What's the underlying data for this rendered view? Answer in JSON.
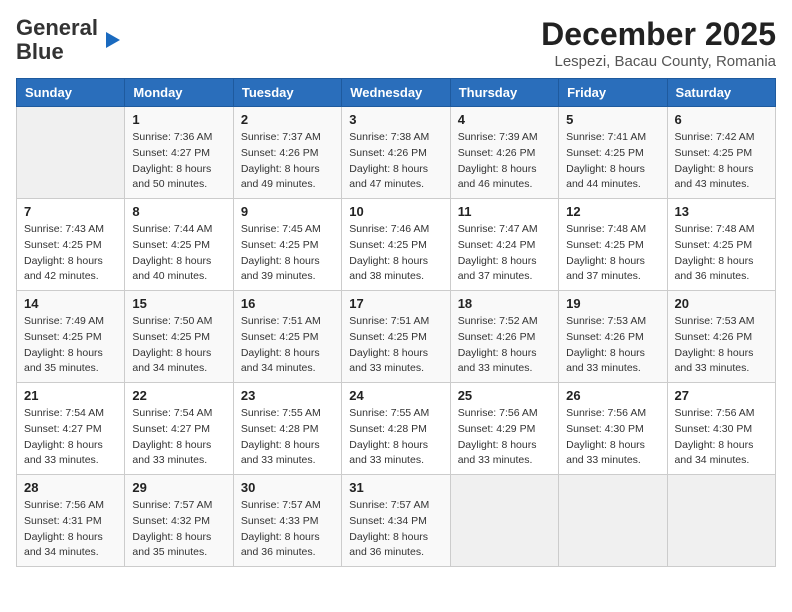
{
  "header": {
    "logo_line1": "General",
    "logo_line2": "Blue",
    "month_year": "December 2025",
    "location": "Lespezi, Bacau County, Romania"
  },
  "days_of_week": [
    "Sunday",
    "Monday",
    "Tuesday",
    "Wednesday",
    "Thursday",
    "Friday",
    "Saturday"
  ],
  "weeks": [
    [
      {
        "day": "",
        "info": ""
      },
      {
        "day": "1",
        "info": "Sunrise: 7:36 AM\nSunset: 4:27 PM\nDaylight: 8 hours\nand 50 minutes."
      },
      {
        "day": "2",
        "info": "Sunrise: 7:37 AM\nSunset: 4:26 PM\nDaylight: 8 hours\nand 49 minutes."
      },
      {
        "day": "3",
        "info": "Sunrise: 7:38 AM\nSunset: 4:26 PM\nDaylight: 8 hours\nand 47 minutes."
      },
      {
        "day": "4",
        "info": "Sunrise: 7:39 AM\nSunset: 4:26 PM\nDaylight: 8 hours\nand 46 minutes."
      },
      {
        "day": "5",
        "info": "Sunrise: 7:41 AM\nSunset: 4:25 PM\nDaylight: 8 hours\nand 44 minutes."
      },
      {
        "day": "6",
        "info": "Sunrise: 7:42 AM\nSunset: 4:25 PM\nDaylight: 8 hours\nand 43 minutes."
      }
    ],
    [
      {
        "day": "7",
        "info": "Sunrise: 7:43 AM\nSunset: 4:25 PM\nDaylight: 8 hours\nand 42 minutes."
      },
      {
        "day": "8",
        "info": "Sunrise: 7:44 AM\nSunset: 4:25 PM\nDaylight: 8 hours\nand 40 minutes."
      },
      {
        "day": "9",
        "info": "Sunrise: 7:45 AM\nSunset: 4:25 PM\nDaylight: 8 hours\nand 39 minutes."
      },
      {
        "day": "10",
        "info": "Sunrise: 7:46 AM\nSunset: 4:25 PM\nDaylight: 8 hours\nand 38 minutes."
      },
      {
        "day": "11",
        "info": "Sunrise: 7:47 AM\nSunset: 4:24 PM\nDaylight: 8 hours\nand 37 minutes."
      },
      {
        "day": "12",
        "info": "Sunrise: 7:48 AM\nSunset: 4:25 PM\nDaylight: 8 hours\nand 37 minutes."
      },
      {
        "day": "13",
        "info": "Sunrise: 7:48 AM\nSunset: 4:25 PM\nDaylight: 8 hours\nand 36 minutes."
      }
    ],
    [
      {
        "day": "14",
        "info": "Sunrise: 7:49 AM\nSunset: 4:25 PM\nDaylight: 8 hours\nand 35 minutes."
      },
      {
        "day": "15",
        "info": "Sunrise: 7:50 AM\nSunset: 4:25 PM\nDaylight: 8 hours\nand 34 minutes."
      },
      {
        "day": "16",
        "info": "Sunrise: 7:51 AM\nSunset: 4:25 PM\nDaylight: 8 hours\nand 34 minutes."
      },
      {
        "day": "17",
        "info": "Sunrise: 7:51 AM\nSunset: 4:25 PM\nDaylight: 8 hours\nand 33 minutes."
      },
      {
        "day": "18",
        "info": "Sunrise: 7:52 AM\nSunset: 4:26 PM\nDaylight: 8 hours\nand 33 minutes."
      },
      {
        "day": "19",
        "info": "Sunrise: 7:53 AM\nSunset: 4:26 PM\nDaylight: 8 hours\nand 33 minutes."
      },
      {
        "day": "20",
        "info": "Sunrise: 7:53 AM\nSunset: 4:26 PM\nDaylight: 8 hours\nand 33 minutes."
      }
    ],
    [
      {
        "day": "21",
        "info": "Sunrise: 7:54 AM\nSunset: 4:27 PM\nDaylight: 8 hours\nand 33 minutes."
      },
      {
        "day": "22",
        "info": "Sunrise: 7:54 AM\nSunset: 4:27 PM\nDaylight: 8 hours\nand 33 minutes."
      },
      {
        "day": "23",
        "info": "Sunrise: 7:55 AM\nSunset: 4:28 PM\nDaylight: 8 hours\nand 33 minutes."
      },
      {
        "day": "24",
        "info": "Sunrise: 7:55 AM\nSunset: 4:28 PM\nDaylight: 8 hours\nand 33 minutes."
      },
      {
        "day": "25",
        "info": "Sunrise: 7:56 AM\nSunset: 4:29 PM\nDaylight: 8 hours\nand 33 minutes."
      },
      {
        "day": "26",
        "info": "Sunrise: 7:56 AM\nSunset: 4:30 PM\nDaylight: 8 hours\nand 33 minutes."
      },
      {
        "day": "27",
        "info": "Sunrise: 7:56 AM\nSunset: 4:30 PM\nDaylight: 8 hours\nand 34 minutes."
      }
    ],
    [
      {
        "day": "28",
        "info": "Sunrise: 7:56 AM\nSunset: 4:31 PM\nDaylight: 8 hours\nand 34 minutes."
      },
      {
        "day": "29",
        "info": "Sunrise: 7:57 AM\nSunset: 4:32 PM\nDaylight: 8 hours\nand 35 minutes."
      },
      {
        "day": "30",
        "info": "Sunrise: 7:57 AM\nSunset: 4:33 PM\nDaylight: 8 hours\nand 36 minutes."
      },
      {
        "day": "31",
        "info": "Sunrise: 7:57 AM\nSunset: 4:34 PM\nDaylight: 8 hours\nand 36 minutes."
      },
      {
        "day": "",
        "info": ""
      },
      {
        "day": "",
        "info": ""
      },
      {
        "day": "",
        "info": ""
      }
    ]
  ]
}
